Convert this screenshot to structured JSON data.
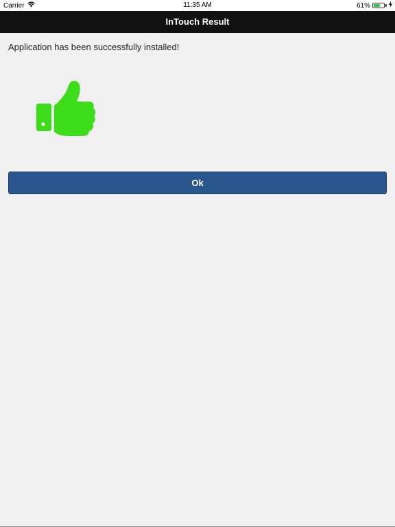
{
  "status_bar": {
    "carrier": "Carrier",
    "time": "11:35 AM",
    "battery_percent": "61%",
    "battery_level": 0.61,
    "wifi_icon": "wifi-icon",
    "charging_icon": "charging-bolt-icon"
  },
  "nav": {
    "title": "InTouch Result"
  },
  "main": {
    "message": "Application has been successfully installed!",
    "icon": "thumbs-up-icon",
    "icon_color": "#3ddc1a",
    "ok_label": "Ok",
    "button_color": "#2b568d"
  }
}
